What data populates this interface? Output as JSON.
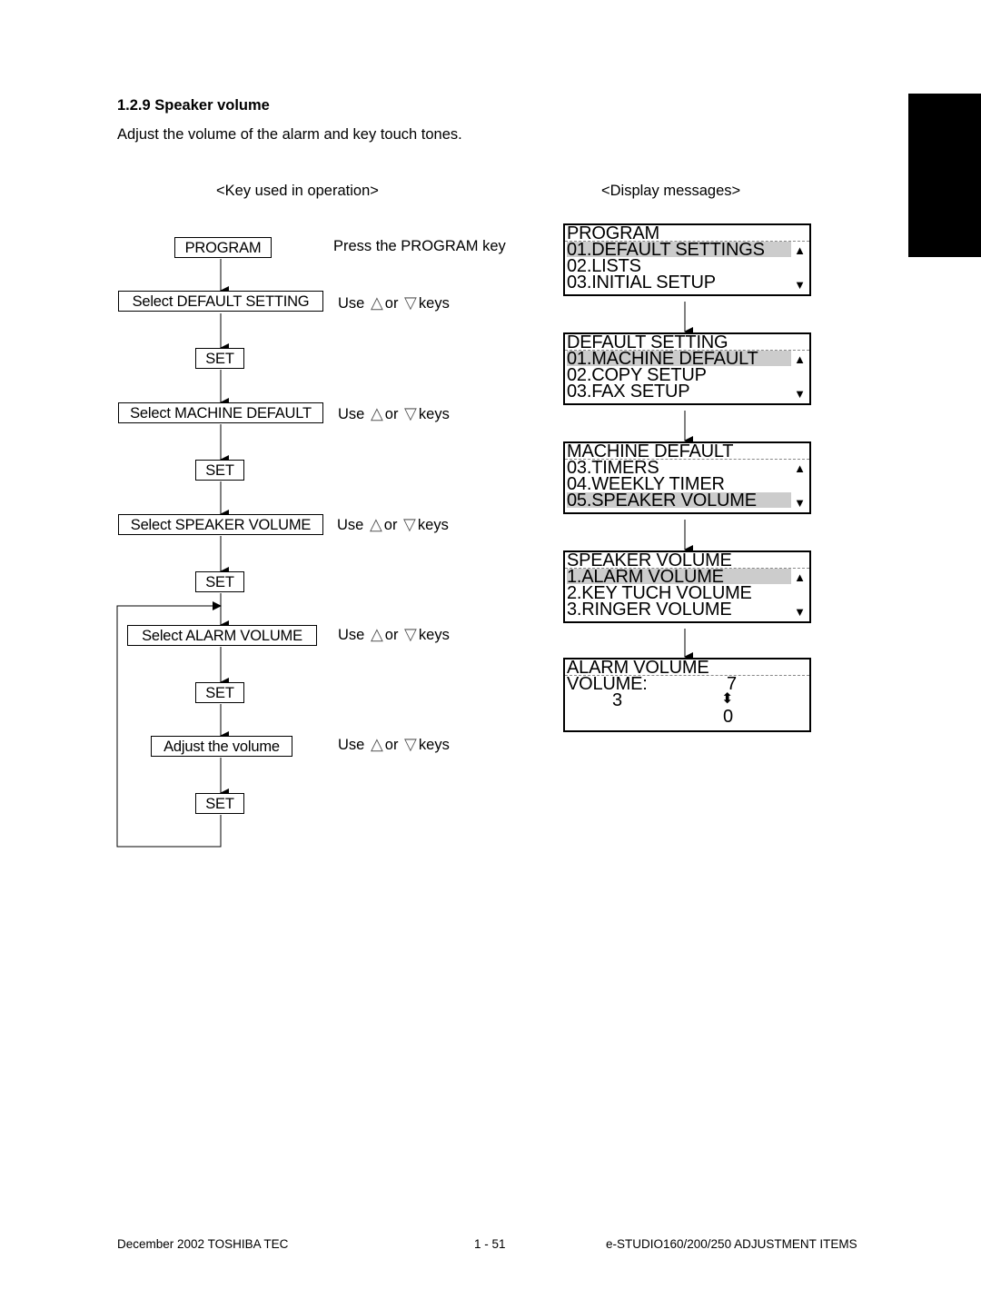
{
  "section": {
    "number": "1.2.9",
    "title": "1.2.9  Speaker volume",
    "intro": "Adjust the volume of the alarm and key touch tones."
  },
  "columns": {
    "keys_header": "<Key used in operation>",
    "display_header": "<Display messages>"
  },
  "flow": {
    "steps": [
      {
        "label": "PROGRAM",
        "note": "Press the PROGRAM key"
      },
      {
        "label": "Select DEFAULT SETTING",
        "note_prefix": "Use",
        "note_mid": "or",
        "note_suffix": "keys"
      },
      {
        "label": "SET"
      },
      {
        "label": "Select MACHINE DEFAULT",
        "note_prefix": "Use",
        "note_mid": "or",
        "note_suffix": "keys"
      },
      {
        "label": "SET"
      },
      {
        "label": "Select SPEAKER VOLUME",
        "note_prefix": "Use",
        "note_mid": "or",
        "note_suffix": "keys"
      },
      {
        "label": "SET"
      },
      {
        "label": "Select ALARM VOLUME",
        "note_prefix": "Use",
        "note_mid": "or",
        "note_suffix": "keys"
      },
      {
        "label": "SET"
      },
      {
        "label": "Adjust the volume",
        "note_prefix": "Use",
        "note_mid": "or",
        "note_suffix": "keys"
      },
      {
        "label": "SET"
      }
    ],
    "up_key_glyph": "△",
    "down_key_glyph": "▽"
  },
  "displays": [
    {
      "title": "PROGRAM",
      "lines": [
        "01.DEFAULT SETTINGS",
        "02.LISTS",
        "03.INITIAL SETUP"
      ],
      "highlighted_index": 0
    },
    {
      "title": "DEFAULT SETTING",
      "lines": [
        "01.MACHINE DEFAULT",
        "02.COPY SETUP",
        "03.FAX SETUP"
      ],
      "highlighted_index": 0
    },
    {
      "title": "MACHINE DEFAULT",
      "lines": [
        "03.TIMERS",
        "04.WEEKLY TIMER",
        "05.SPEAKER VOLUME"
      ],
      "highlighted_index": 2
    },
    {
      "title": "SPEAKER VOLUME",
      "lines": [
        "1.ALARM VOLUME",
        "2.KEY TUCH VOLUME",
        "3.RINGER VOLUME"
      ],
      "highlighted_index": 0
    },
    {
      "title": "ALARM VOLUME",
      "volume_label": "VOLUME:",
      "current_value": "3",
      "max_value": "7",
      "min_value": "0"
    }
  ],
  "scroll_glyphs": {
    "up": "▲",
    "down": "▼",
    "updown": "⬍"
  },
  "footer": {
    "left": "December 2002 TOSHIBA TEC",
    "center": "1 - 51",
    "right": "e-STUDIO160/200/250 ADJUSTMENT ITEMS"
  }
}
